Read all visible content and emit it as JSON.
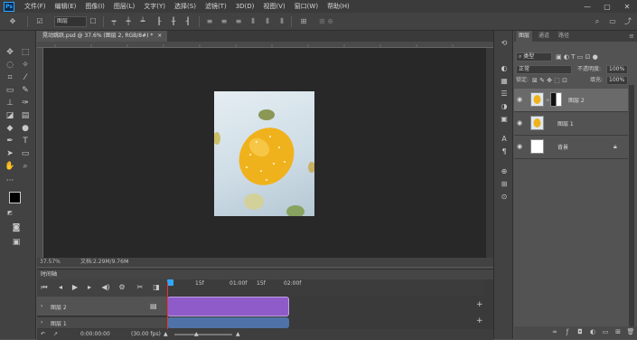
{
  "app": {
    "logo": "Ps"
  },
  "menu": [
    "文件(F)",
    "编辑(E)",
    "图像(I)",
    "图层(L)",
    "文字(Y)",
    "选择(S)",
    "滤镜(T)",
    "3D(D)",
    "视图(V)",
    "窗口(W)",
    "帮助(H)"
  ],
  "window_controls": [
    "—",
    "▢",
    "✕"
  ],
  "options_bar": {
    "layer_select": "图层"
  },
  "document": {
    "tab_title": "晃动跳跃.psd @ 37.6% (图层 2, RGB/8#) *",
    "close": "×"
  },
  "status": {
    "zoom": "37.57%",
    "doc_size": "文档:2.29M/9.76M"
  },
  "timeline": {
    "title": "时间轴",
    "ticks": [
      "15f",
      "01:00f",
      "15f",
      "02:00f"
    ],
    "tracks": [
      {
        "name": "图层 2"
      },
      {
        "name": "图层 1"
      }
    ],
    "current_time": "0:00:00:00",
    "fps": "(30.00 fps)",
    "add": "+"
  },
  "layers_panel": {
    "tabs": [
      "图层",
      "通道",
      "路径"
    ],
    "filter_label": "类型",
    "blend_mode": "正常",
    "opacity_label": "不透明度:",
    "opacity_value": "100%",
    "lock_label": "锁定:",
    "fill_label": "填充:",
    "fill_value": "100%",
    "layers": [
      {
        "name": "图层 2"
      },
      {
        "name": "图层 1"
      },
      {
        "name": "背景"
      }
    ]
  },
  "colors": {
    "accent": "#31a8ff",
    "clip_purple": "#8f5bc9",
    "clip_blue": "#4f73a8",
    "lemon": "#f0b21c",
    "leaf": "#7c8a3a"
  }
}
